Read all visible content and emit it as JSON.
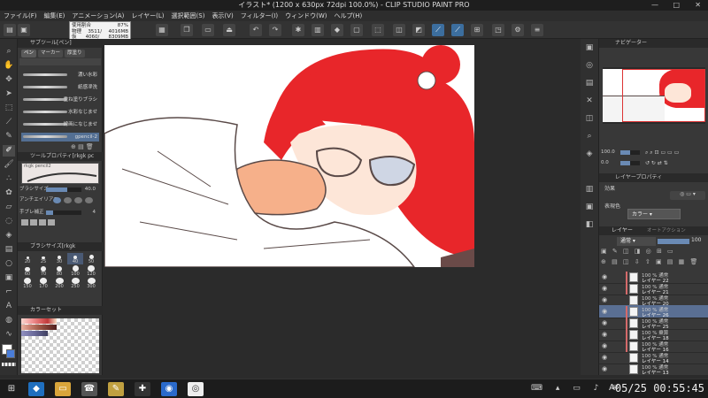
{
  "window": {
    "title": "イラスト* (1200 x 630px 72dpi 100.0%) - CLIP STUDIO PAINT PRO",
    "minimize_icon": "minimize-icon",
    "maximize_icon": "maximize-icon",
    "close_icon": "close-icon"
  },
  "menu": [
    "ファイル(F)",
    "編集(E)",
    "アニメーション(A)",
    "レイヤー(L)",
    "選択範囲(S)",
    "表示(V)",
    "フィルター(I)",
    "ウィンドウ(W)",
    "ヘルプ(H)"
  ],
  "memory_tooltip": {
    "rows": [
      {
        "label": "使用割合",
        "v1": "",
        "v2": "87%"
      },
      {
        "label": "物理",
        "v1": "3511/",
        "v2": "4016MB"
      },
      {
        "label": "仮",
        "v1": "4060/",
        "v2": "8309MB"
      }
    ]
  },
  "subtool": {
    "title": "サブツール[ペン]",
    "tabs": [
      "ペン",
      "マーカー",
      "厚塗り"
    ],
    "brushes": [
      {
        "label": "濃い水彩",
        "selected": false
      },
      {
        "label": "紙感滲洗",
        "selected": false
      },
      {
        "label": "重ね塗りブラシ",
        "selected": false
      },
      {
        "label": "水彩なじませ",
        "selected": false
      },
      {
        "label": "線画になじませ",
        "selected": false
      },
      {
        "label": "gpencil-2",
        "selected": true
      }
    ]
  },
  "tool_property": {
    "title": "ツールプロパティ[rkgk pc",
    "brush_name": "rkgk pencil2",
    "brush_size_label": "ブラシサイズ",
    "brush_size_value": "40.0",
    "antialias_label": "アンチエイリアス",
    "stabilize_label": "手ブレ補正",
    "stabilize_value": "4"
  },
  "brush_size_palette": {
    "title": "ブラシサイズ[rkgk",
    "sizes": [
      "20",
      "25",
      "30",
      "40",
      "50",
      "60",
      "70",
      "80",
      "100",
      "120",
      "150",
      "170",
      "200",
      "250",
      "300"
    ],
    "selected": "40"
  },
  "color_set": {
    "title": "カラーセット"
  },
  "canvas": {
    "zoom": "100.0"
  },
  "navigator": {
    "title": "ナビゲーター",
    "zoom": "100.0",
    "rotate": "0.0"
  },
  "layer_property": {
    "title": "レイヤープロパティ",
    "effect_label": "効果",
    "expression_label": "表現色",
    "expression_value": "カラー"
  },
  "layer_panel": {
    "title": "レイヤー",
    "tab2": "オートアクション",
    "blend": "通常",
    "opacity": "100",
    "layers": [
      {
        "mode": "100 % 通常",
        "name": "レイヤー 22",
        "selected": false,
        "marked": true
      },
      {
        "mode": "100 % 通常",
        "name": "レイヤー 21",
        "selected": false,
        "marked": true
      },
      {
        "mode": "100 % 通常",
        "name": "レイヤー 20",
        "selected": false,
        "marked": false
      },
      {
        "mode": "100 % 通常",
        "name": "レイヤー 26",
        "selected": true,
        "marked": true
      },
      {
        "mode": "100 % 通常",
        "name": "レイヤー 25",
        "selected": false,
        "marked": true
      },
      {
        "mode": "100 % 乗算",
        "name": "レイヤー 18",
        "selected": false,
        "marked": true
      },
      {
        "mode": "100 % 通常",
        "name": "レイヤー 16",
        "selected": false,
        "marked": true
      },
      {
        "mode": "100 % 通常",
        "name": "レイヤー 14",
        "selected": false,
        "marked": false
      },
      {
        "mode": "100 % 通常",
        "name": "レイヤー 13",
        "selected": false,
        "marked": false
      }
    ]
  },
  "taskbar": {
    "clock": "05/25 00:55:45",
    "ime": "A",
    "start_icon": "windows-start-icon"
  },
  "colors": {
    "hair_red": "#e8262a",
    "skin": "#f6b08a",
    "line": "#5a4a48",
    "accent": "#3c6e9e"
  }
}
